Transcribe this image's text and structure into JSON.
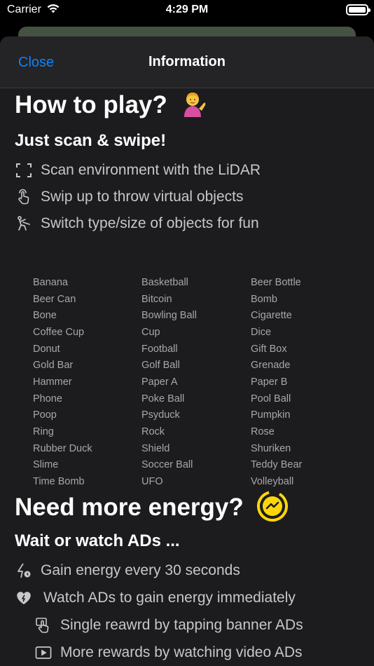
{
  "status_bar": {
    "carrier": "Carrier",
    "time": "4:29 PM"
  },
  "navbar": {
    "close_label": "Close",
    "title": "Information"
  },
  "how_to_play": {
    "title": "How to play?",
    "subtitle": "Just scan & swipe!",
    "features": [
      {
        "icon": "scan-frame-icon",
        "text": "Scan environment with the LiDAR"
      },
      {
        "icon": "hand-swipe-icon",
        "text": "Swip up to throw virtual objects"
      },
      {
        "icon": "person-throw-icon",
        "text": "Switch type/size of objects for fun"
      }
    ],
    "objects": [
      "Banana",
      "Basketball",
      "Beer Bottle",
      "Beer Can",
      "Bitcoin",
      "Bomb",
      "Bone",
      "Bowling Ball",
      "Cigarette",
      "Coffee Cup",
      "Cup",
      "Dice",
      "Donut",
      "Football",
      "Gift Box",
      "Gold Bar",
      "Golf Ball",
      "Grenade",
      "Hammer",
      "Paper A",
      "Paper B",
      "Phone",
      "Poke Ball",
      "Pool Ball",
      "Poop",
      "Psyduck",
      "Pumpkin",
      "Ring",
      "Rock",
      "Rose",
      "Rubber Duck",
      "Shield",
      "Shuriken",
      "Slime",
      "Soccer Ball",
      "Teddy Bear",
      "Time Bomb",
      "UFO",
      "Volleyball"
    ]
  },
  "energy": {
    "title": "Need more energy?",
    "subtitle": "Wait or watch ADs ...",
    "features": [
      {
        "icon": "bolt-timer-icon",
        "text": "Gain energy every 30 seconds"
      },
      {
        "icon": "heart-bolt-icon",
        "text": "Watch ADs to gain energy immediately"
      },
      {
        "icon": "hand-tap-icon",
        "text": "Single reawrd by tapping banner ADs"
      },
      {
        "icon": "play-rectangle-icon",
        "text": "More rewards by watching video ADs"
      }
    ]
  },
  "colors": {
    "accent": "#0a84ff",
    "energy_yellow": "#ffd60a",
    "sheet_bg": "#1c1c1e"
  }
}
